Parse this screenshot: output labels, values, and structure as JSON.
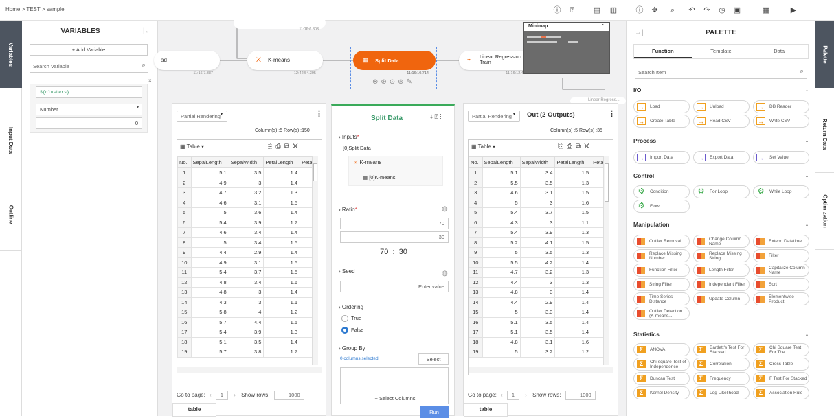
{
  "breadcrumb": "Home > TEST > sample",
  "left_tabs": [
    "Variables",
    "Input Data",
    "Outline"
  ],
  "right_tabs": [
    "Palette",
    "Return Data",
    "Optimization"
  ],
  "variables": {
    "title": "VARIABLES",
    "add_label": "+ Add Variable",
    "search_placeholder": "Search Variable",
    "var_name": "${clusters}",
    "var_type": "Number",
    "var_value": "0"
  },
  "nodes": {
    "load_label": "ad",
    "load_time": "11:16:7.387",
    "top_time": "11:16:6.803",
    "kmeans_label": "K-means",
    "kmeans_time": "12:42:54.395",
    "split_label": "Split Data",
    "split_time": "11:16:10.714",
    "lr_label1": "Linear Regression",
    "lr_label2": "Train",
    "lr_time": "11:16:12.427",
    "lr2_label": "Linear Regress..."
  },
  "minimap_label": "Minimap",
  "left_table": {
    "render_mode": "Partial Rendering",
    "summary": "Column(s) :5   Row(s) :150",
    "view_label": "Table",
    "columns": [
      "No.",
      "SepalLength",
      "SepalWidth",
      "PetalLength",
      "Petal"
    ],
    "rows": [
      [
        "1",
        "5.1",
        "3.5",
        "1.4"
      ],
      [
        "2",
        "4.9",
        "3",
        "1.4"
      ],
      [
        "3",
        "4.7",
        "3.2",
        "1.3"
      ],
      [
        "4",
        "4.6",
        "3.1",
        "1.5"
      ],
      [
        "5",
        "5",
        "3.6",
        "1.4"
      ],
      [
        "6",
        "5.4",
        "3.9",
        "1.7"
      ],
      [
        "7",
        "4.6",
        "3.4",
        "1.4"
      ],
      [
        "8",
        "5",
        "3.4",
        "1.5"
      ],
      [
        "9",
        "4.4",
        "2.9",
        "1.4"
      ],
      [
        "10",
        "4.9",
        "3.1",
        "1.5"
      ],
      [
        "11",
        "5.4",
        "3.7",
        "1.5"
      ],
      [
        "12",
        "4.8",
        "3.4",
        "1.6"
      ],
      [
        "13",
        "4.8",
        "3",
        "1.4"
      ],
      [
        "14",
        "4.3",
        "3",
        "1.1"
      ],
      [
        "15",
        "5.8",
        "4",
        "1.2"
      ],
      [
        "16",
        "5.7",
        "4.4",
        "1.5"
      ],
      [
        "17",
        "5.4",
        "3.9",
        "1.3"
      ],
      [
        "18",
        "5.1",
        "3.5",
        "1.4"
      ],
      [
        "19",
        "5.7",
        "3.8",
        "1.7"
      ]
    ],
    "goto_label": "Go to page:",
    "page": "1",
    "show_rows_label": "Show rows:",
    "show_rows": "1000",
    "tab": "table"
  },
  "right_table": {
    "render_mode": "Partial Rendering",
    "title": "Out (2 Outputs)",
    "summary": "Column(s) :5   Row(s) :35",
    "view_label": "Table",
    "columns": [
      "No.",
      "SepalLength",
      "SepalWidth",
      "PetalLength",
      "Petal"
    ],
    "rows": [
      [
        "1",
        "5.1",
        "3.4",
        "1.5"
      ],
      [
        "2",
        "5.5",
        "3.5",
        "1.3"
      ],
      [
        "3",
        "4.6",
        "3.1",
        "1.5"
      ],
      [
        "4",
        "5",
        "3",
        "1.6"
      ],
      [
        "5",
        "5.4",
        "3.7",
        "1.5"
      ],
      [
        "6",
        "4.3",
        "3",
        "1.1"
      ],
      [
        "7",
        "5.4",
        "3.9",
        "1.3"
      ],
      [
        "8",
        "5.2",
        "4.1",
        "1.5"
      ],
      [
        "9",
        "5",
        "3.5",
        "1.3"
      ],
      [
        "10",
        "5.5",
        "4.2",
        "1.4"
      ],
      [
        "11",
        "4.7",
        "3.2",
        "1.3"
      ],
      [
        "12",
        "4.4",
        "3",
        "1.3"
      ],
      [
        "13",
        "4.8",
        "3",
        "1.4"
      ],
      [
        "14",
        "4.4",
        "2.9",
        "1.4"
      ],
      [
        "15",
        "5",
        "3.3",
        "1.4"
      ],
      [
        "16",
        "5.1",
        "3.5",
        "1.4"
      ],
      [
        "17",
        "5.1",
        "3.5",
        "1.4"
      ],
      [
        "18",
        "4.8",
        "3.1",
        "1.6"
      ],
      [
        "19",
        "5",
        "3.2",
        "1.2"
      ]
    ],
    "goto_label": "Go to page:",
    "page": "1",
    "show_rows_label": "Show rows:",
    "show_rows": "1000",
    "tab": "table"
  },
  "split_panel": {
    "title": "Split Data",
    "inputs_label": "Inputs",
    "input_name": "[0]Split Data",
    "input_node": "K-means",
    "input_sub": "[0]K-means",
    "ratio_label": "Ratio",
    "ratio_a": "70",
    "ratio_b": "30",
    "ratio_display": "70  :  30",
    "seed_label": "Seed",
    "seed_placeholder": "Enter value",
    "ordering_label": "Ordering",
    "opt_true": "True",
    "opt_false": "False",
    "groupby_label": "Group By",
    "cols_selected": "0 columns selected",
    "select_btn": "Select",
    "select_cols": "+ Select Columns",
    "run_btn": "Run"
  },
  "palette": {
    "title": "PALETTE",
    "tabs": [
      "Function",
      "Template",
      "Data"
    ],
    "search_placeholder": "Search Item",
    "io_title": "I/O",
    "io": [
      "Load",
      "Unload",
      "DB Reader",
      "Create Table",
      "Read CSV",
      "Write CSV"
    ],
    "process_title": "Process",
    "process": [
      "Import Data",
      "Export Data",
      "Set Value"
    ],
    "control_title": "Control",
    "control": [
      "Condition",
      "For Loop",
      "While Loop",
      "Flow"
    ],
    "manip_title": "Manipulation",
    "manip": [
      "Outlier Removal",
      "Change Column Name",
      "Extend Datetime",
      "Replace Missing Number",
      "Replace Missing String",
      "Filter",
      "Function Filter",
      "Length Filter",
      "Capitalize Column Name",
      "String Filter",
      "Independent Filter",
      "Sort",
      "Time Series Distance",
      "Update Column",
      "Elementwise Product",
      "Outlier Detection (K-means..."
    ],
    "stats_title": "Statistics",
    "stats": [
      "ANOVA",
      "Bartlett's Test For Stacked...",
      "Chi Square Test For The...",
      "Chi-square Test of Independence",
      "Correlation",
      "Cross Table",
      "Duncan Test",
      "Frequency",
      "F Test For Stacked",
      "Kernel Density",
      "Log Likelihood",
      "Association Rule"
    ]
  },
  "colors": {
    "accent": "#f0650e",
    "sidebar_dark": "#4d5560",
    "primary": "#5b8ee6"
  }
}
